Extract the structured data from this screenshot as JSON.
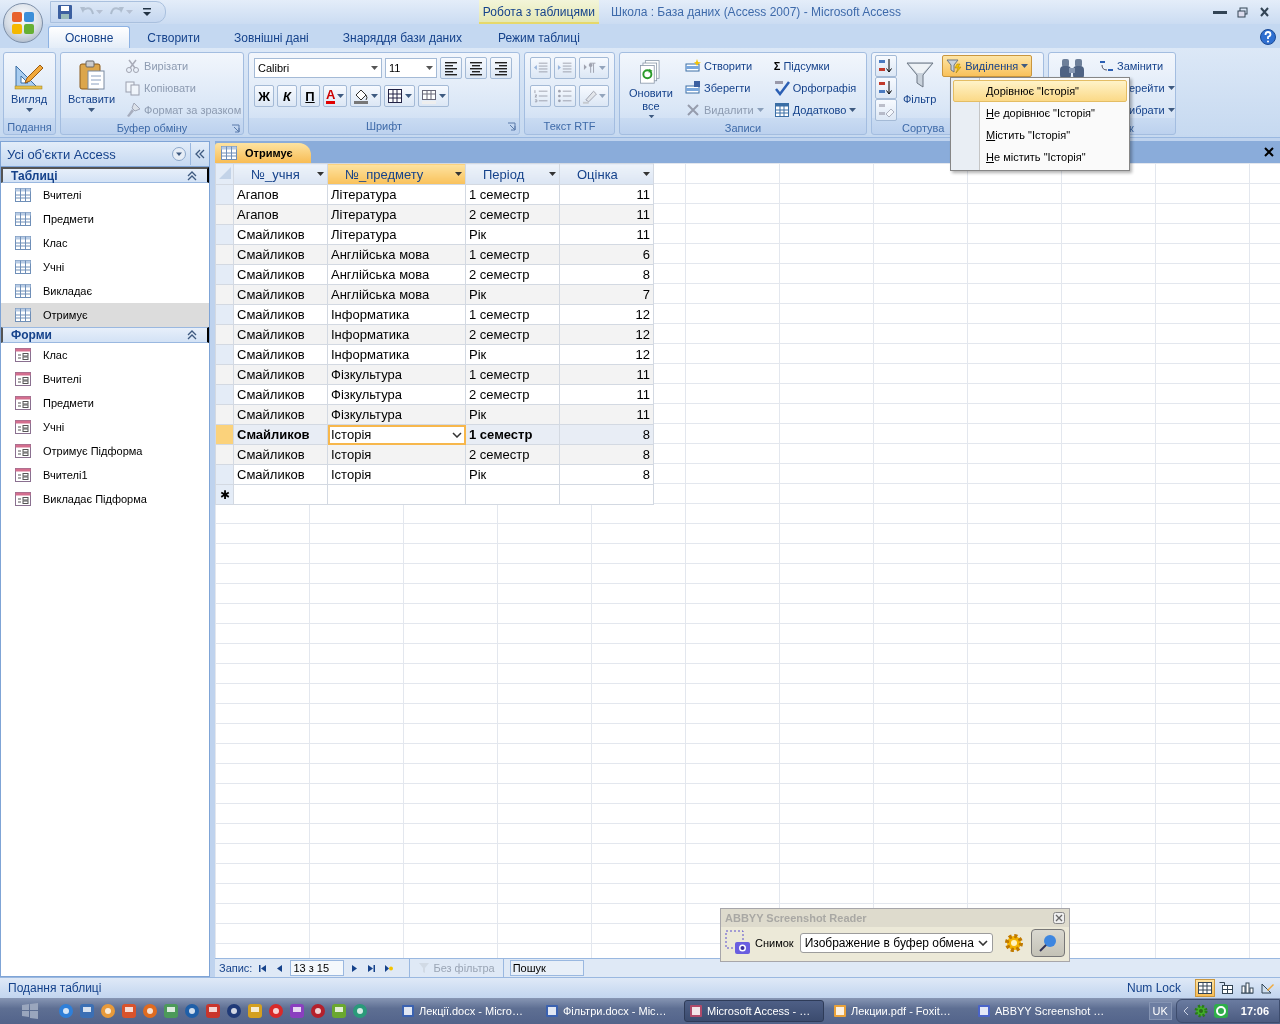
{
  "window": {
    "title": "Школа : База даних (Access 2007)  - Microsoft Access",
    "context_tab": "Робота з таблицями"
  },
  "quick_access": [
    {
      "kind": "save",
      "disabled": false
    },
    {
      "kind": "undo",
      "disabled": true
    },
    {
      "kind": "redo",
      "disabled": true
    },
    {
      "kind": "customize",
      "disabled": false
    }
  ],
  "ribbon_tabs": [
    {
      "label": "Основне",
      "selected": true
    },
    {
      "label": "Створити",
      "selected": false
    },
    {
      "label": "Зовнішні дані",
      "selected": false
    },
    {
      "label": "Знаряддя бази даних",
      "selected": false
    },
    {
      "label": "Режим таблиці",
      "selected": false
    }
  ],
  "ribbon": {
    "groups": [
      {
        "label": "Подання",
        "launcher": false,
        "items": [
          {
            "kind": "large",
            "label": "Вигляд",
            "dropdown": true
          }
        ]
      },
      {
        "label": "Буфер обміну",
        "launcher": true,
        "items": [
          {
            "kind": "large",
            "label": "Вставити",
            "dropdown": true
          },
          {
            "kind": "small",
            "label": "Вирізати",
            "disabled": true
          },
          {
            "kind": "small",
            "label": "Копіювати",
            "disabled": true
          },
          {
            "kind": "small",
            "label": "Формат за зразком",
            "disabled": true
          }
        ]
      },
      {
        "label": "Шрифт",
        "launcher": true,
        "toolbars": [
          {
            "items": [
              {
                "kind": "combo",
                "value": "Calibri"
              },
              {
                "kind": "combo",
                "value": "11"
              },
              {
                "kind": "tool"
              },
              {
                "kind": "tool"
              },
              {
                "kind": "tool"
              }
            ]
          },
          {
            "items": [
              {
                "kind": "tool",
                "label": "Ж"
              },
              {
                "kind": "tool",
                "label": "К"
              },
              {
                "kind": "tool",
                "label": "П"
              },
              {
                "kind": "tool",
                "label": "A",
                "dropdown": true
              },
              {
                "kind": "tool",
                "dropdown": true
              },
              {
                "kind": "tool",
                "dropdown": true
              },
              {
                "kind": "tool",
                "dropdown": true
              }
            ]
          }
        ]
      },
      {
        "label": "Текст RTF",
        "launcher": false,
        "toolbars": [
          {
            "items": [
              {
                "kind": "tool",
                "disabled": true
              },
              {
                "kind": "tool",
                "disabled": true
              },
              {
                "kind": "tool",
                "disabled": true,
                "dropdown": true
              }
            ]
          },
          {
            "items": [
              {
                "kind": "tool",
                "disabled": true
              },
              {
                "kind": "tool",
                "disabled": true
              },
              {
                "kind": "tool",
                "disabled": true,
                "dropdown": true
              }
            ]
          }
        ]
      },
      {
        "label": "Записи",
        "launcher": false,
        "items": [
          {
            "kind": "large",
            "label": "Оновити все",
            "dropdown": true
          },
          {
            "kind": "small",
            "label": "Створити"
          },
          {
            "kind": "small",
            "label": "Зберегти"
          },
          {
            "kind": "small",
            "label": "Видалити",
            "disabled": true,
            "dropdown": true
          },
          {
            "kind": "small",
            "glyph": "Σ",
            "label": "Підсумки"
          },
          {
            "kind": "small",
            "label": "Орфографія"
          },
          {
            "kind": "small",
            "label": "Додатково",
            "dropdown": true
          }
        ]
      },
      {
        "label": "Сортува",
        "launcher": false,
        "items": [
          {
            "kind": "tool"
          },
          {
            "kind": "tool"
          },
          {
            "kind": "tool",
            "disabled": true
          },
          {
            "kind": "large",
            "label": "Фільтр"
          },
          {
            "kind": "small",
            "label": "Виділення",
            "dropdown": true,
            "pressed": true
          }
        ]
      },
      {
        "label": "к",
        "launcher": false,
        "items": [
          {
            "kind": "large"
          },
          {
            "kind": "small",
            "label": "Замінити"
          },
          {
            "kind": "small",
            "label": "ерейти",
            "dropdown": true
          },
          {
            "kind": "small",
            "label": "ибрати",
            "dropdown": true
          }
        ]
      }
    ]
  },
  "selection_menu": [
    {
      "label": "Дорівнює \"Історія\"",
      "selected": true
    },
    {
      "label": "Не дорівнює \"Історія\"",
      "selected": false
    },
    {
      "label": "Містить \"Історія\"",
      "selected": false
    },
    {
      "label": "Не містить \"Історія\"",
      "selected": false
    }
  ],
  "nav_pane": {
    "title": "Усі об'єкти Access",
    "groups": [
      {
        "label": "Таблиці",
        "kind": "table",
        "items": [
          {
            "label": "Вчителі",
            "selected": false
          },
          {
            "label": "Предмети",
            "selected": false
          },
          {
            "label": "Клас",
            "selected": false
          },
          {
            "label": "Учні",
            "selected": false
          },
          {
            "label": "Викладає",
            "selected": false
          },
          {
            "label": "Отримує",
            "selected": true
          }
        ]
      },
      {
        "label": "Форми",
        "kind": "form",
        "items": [
          {
            "label": "Клас",
            "selected": false
          },
          {
            "label": "Вчителі",
            "selected": false
          },
          {
            "label": "Предмети",
            "selected": false
          },
          {
            "label": "Учні",
            "selected": false
          },
          {
            "label": "Отримує Підформа",
            "selected": false
          },
          {
            "label": "Вчителі1",
            "selected": false
          },
          {
            "label": "Викладає Підформа",
            "selected": false
          }
        ]
      }
    ]
  },
  "document": {
    "tab": "Отримує",
    "columns": [
      {
        "label": "№_учня",
        "kind": "text",
        "current": false
      },
      {
        "label": "№_предмету",
        "kind": "text",
        "current": true
      },
      {
        "label": "Період",
        "kind": "text",
        "current": false
      },
      {
        "label": "Оцінка",
        "kind": "number",
        "current": false
      }
    ],
    "rows": [
      {
        "cells": [
          "Агапов",
          "Література",
          "1 семестр",
          "11"
        ],
        "selected": false
      },
      {
        "cells": [
          "Агапов",
          "Література",
          "2 семестр",
          "11"
        ],
        "selected": false
      },
      {
        "cells": [
          "Смайликов",
          "Література",
          "Рік",
          "11"
        ],
        "selected": false
      },
      {
        "cells": [
          "Смайликов",
          "Англійська мова",
          "1 семестр",
          "6"
        ],
        "selected": false
      },
      {
        "cells": [
          "Смайликов",
          "Англійська мова",
          "2 семестр",
          "8"
        ],
        "selected": false
      },
      {
        "cells": [
          "Смайликов",
          "Англійська мова",
          "Рік",
          "7"
        ],
        "selected": false
      },
      {
        "cells": [
          "Смайликов",
          "Інформатика",
          "1 семестр",
          "12"
        ],
        "selected": false
      },
      {
        "cells": [
          "Смайликов",
          "Інформатика",
          "2 семестр",
          "12"
        ],
        "selected": false
      },
      {
        "cells": [
          "Смайликов",
          "Інформатика",
          "Рік",
          "12"
        ],
        "selected": false
      },
      {
        "cells": [
          "Смайликов",
          "Фізкультура",
          "1 семестр",
          "11"
        ],
        "selected": false
      },
      {
        "cells": [
          "Смайликов",
          "Фізкультура",
          "2 семестр",
          "11"
        ],
        "selected": false
      },
      {
        "cells": [
          "Смайликов",
          "Фізкультура",
          "Рік",
          "11"
        ],
        "selected": false
      },
      {
        "cells": [
          "Смайликов",
          "Історія",
          "1 семестр",
          "8"
        ],
        "selected": true
      },
      {
        "cells": [
          "Смайликов",
          "Історія",
          "2 семестр",
          "8"
        ],
        "selected": false
      },
      {
        "cells": [
          "Смайликов",
          "Історія",
          "Рік",
          "8"
        ],
        "selected": false
      }
    ],
    "new_row_marker": "✱",
    "record_nav": {
      "label": "Запис:",
      "position": "13 з 15",
      "filter": "Без фільтра",
      "filter_active": false,
      "search_placeholder": "Пошук"
    }
  },
  "status_bar": {
    "text": "Подання таблиці",
    "indicator": "Num Lock",
    "views": [
      {
        "selected": true
      },
      {
        "selected": false
      },
      {
        "selected": false
      },
      {
        "selected": false
      }
    ]
  },
  "taskbar": {
    "tasks": [
      {
        "label": "Лекції.docx - Micro…",
        "selected": false
      },
      {
        "label": "Фільтри.docx - Mic…",
        "selected": false
      },
      {
        "label": "Microsoft Access - …",
        "selected": true
      },
      {
        "label": "Лекции.pdf - Foxit…",
        "selected": false
      },
      {
        "label": "ABBYY Screenshot …",
        "selected": false
      }
    ],
    "language": "UK",
    "clock": "17:06"
  },
  "abbyy": {
    "title": "ABBYY Screenshot Reader",
    "active": false,
    "capture_label": "Снимок",
    "destination": "Изображение в буфер обмена",
    "pinned": true
  }
}
